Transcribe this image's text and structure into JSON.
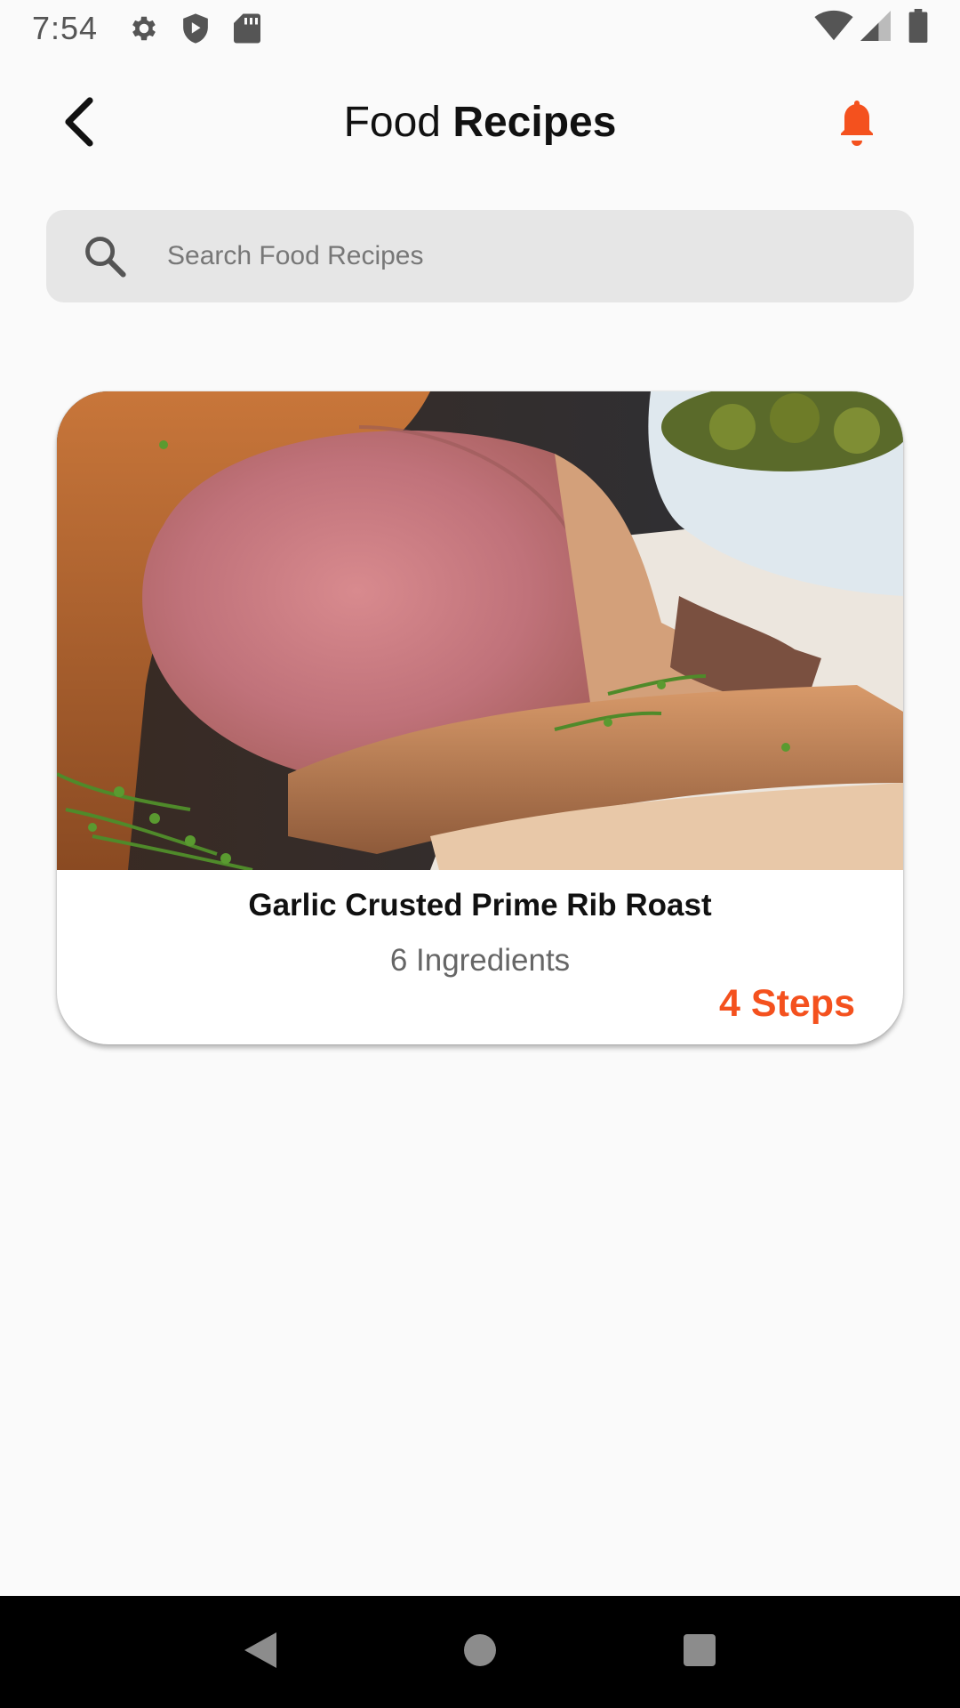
{
  "status_bar": {
    "time": "7:54",
    "left_icons": [
      "gear-icon",
      "shield-icon",
      "sd-card-icon"
    ],
    "right_icons": [
      "wifi-icon",
      "cell-signal-icon",
      "battery-icon"
    ]
  },
  "app_bar": {
    "title_light": "Food",
    "title_bold": "Recipes",
    "accent_color": "#f4511e"
  },
  "search": {
    "placeholder": "Search Food Recipes",
    "value": ""
  },
  "recipes": [
    {
      "name": "Garlic Crusted Prime Rib Roast",
      "ingredients": "6 Ingredients",
      "steps": "4 Steps"
    }
  ],
  "nav_bar": {
    "buttons": [
      "back-triangle-icon",
      "home-circle-icon",
      "recents-square-icon"
    ]
  }
}
